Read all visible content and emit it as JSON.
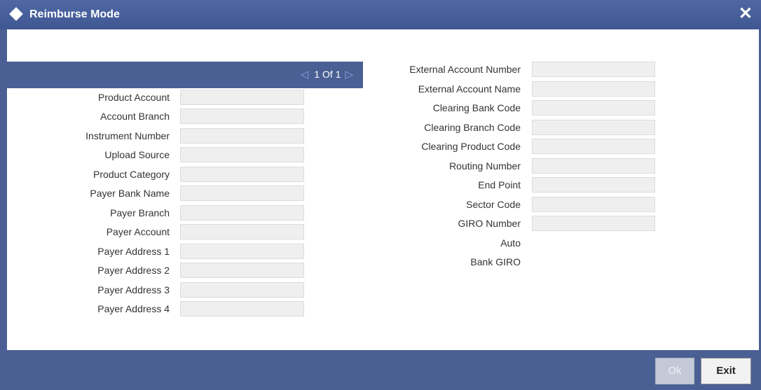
{
  "window": {
    "title": "Reimburse Mode",
    "close_label": "✕"
  },
  "pager": {
    "text": "1 Of 1",
    "prev_icon": "chevron-left-icon",
    "next_icon": "chevron-right-icon"
  },
  "left_fields": [
    {
      "label": "Product Account",
      "value": ""
    },
    {
      "label": "Account Branch",
      "value": ""
    },
    {
      "label": "Instrument Number",
      "value": ""
    },
    {
      "label": "Upload Source",
      "value": ""
    },
    {
      "label": "Product Category",
      "value": ""
    },
    {
      "label": "Payer Bank Name",
      "value": ""
    },
    {
      "label": "Payer Branch",
      "value": ""
    },
    {
      "label": "Payer Account",
      "value": ""
    },
    {
      "label": "Payer Address 1",
      "value": ""
    },
    {
      "label": "Payer Address 2",
      "value": ""
    },
    {
      "label": "Payer Address 3",
      "value": ""
    },
    {
      "label": "Payer Address 4",
      "value": ""
    }
  ],
  "right_fields": [
    {
      "label": "External Account Number",
      "value": ""
    },
    {
      "label": "External Account Name",
      "value": ""
    },
    {
      "label": "Clearing Bank Code",
      "value": ""
    },
    {
      "label": "Clearing Branch Code",
      "value": ""
    },
    {
      "label": "Clearing Product Code",
      "value": ""
    },
    {
      "label": "Routing Number",
      "value": ""
    },
    {
      "label": "End Point",
      "value": ""
    },
    {
      "label": "Sector Code",
      "value": ""
    },
    {
      "label": "GIRO Number",
      "value": ""
    }
  ],
  "right_labels": [
    "Auto",
    "Bank GIRO"
  ],
  "footer": {
    "ok_label": "Ok",
    "exit_label": "Exit"
  },
  "colors": {
    "frame": "#4a5f93",
    "title_bar": "#4f68a5",
    "field_bg": "#efefef"
  }
}
